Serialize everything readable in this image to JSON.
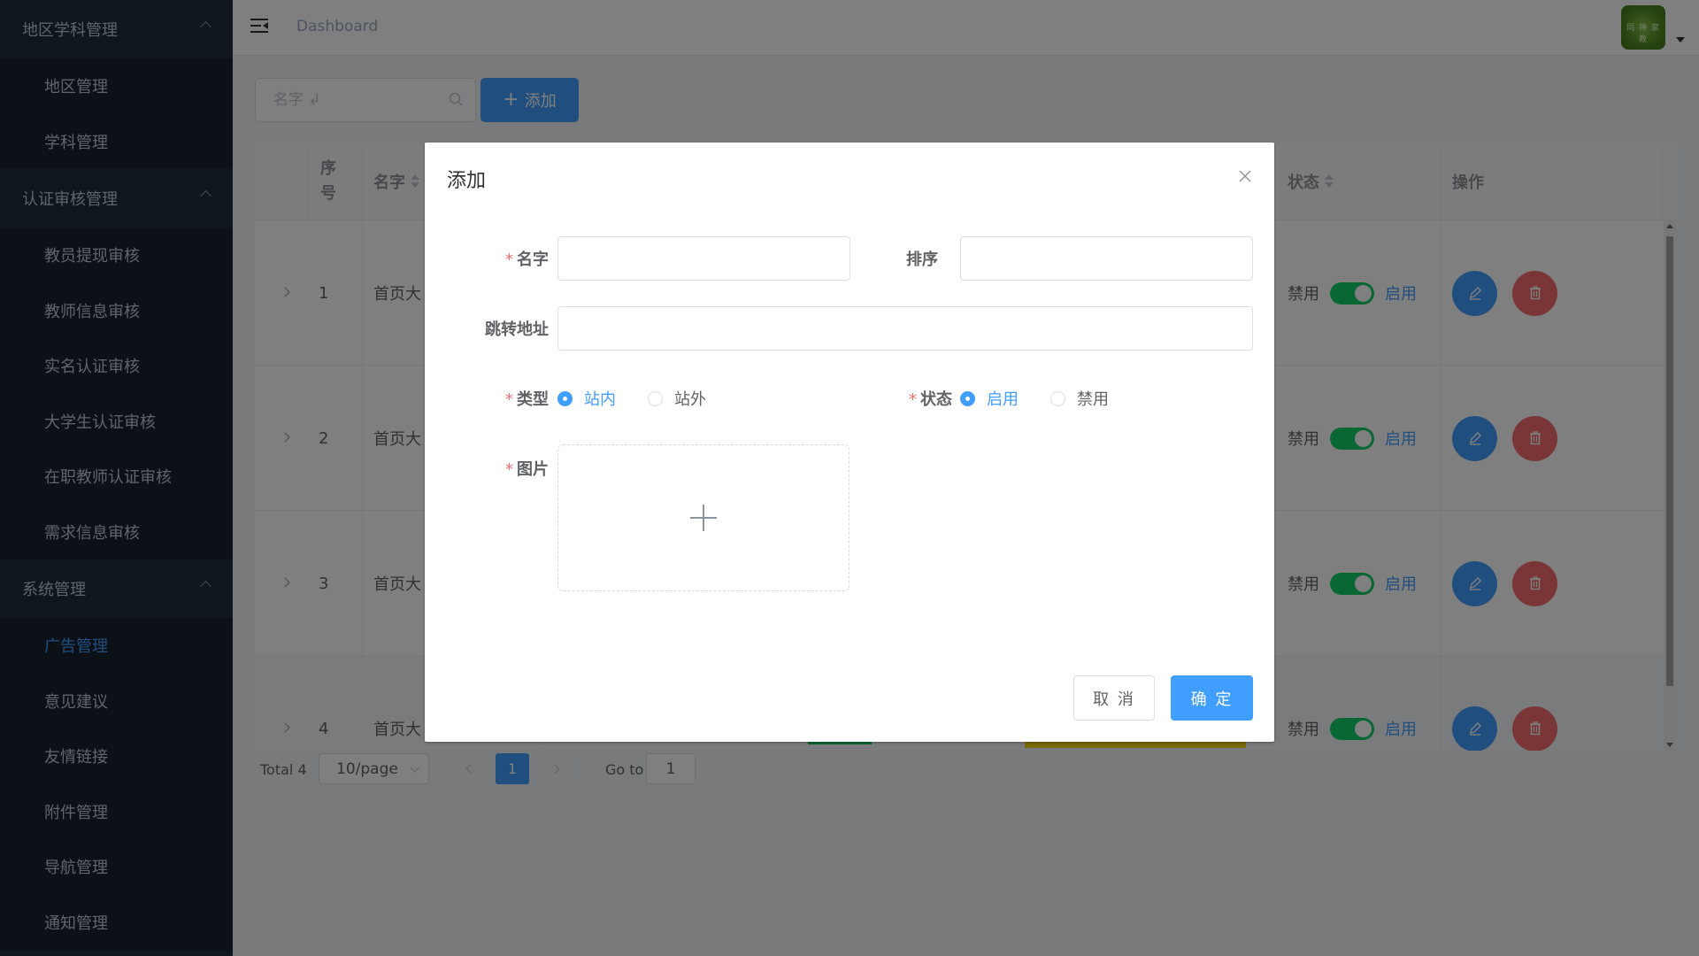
{
  "sidebar": {
    "groups": [
      {
        "label": "地区学科管理",
        "items": [
          "地区管理",
          "学科管理"
        ]
      },
      {
        "label": "认证审核管理",
        "items": [
          "教员提现审核",
          "教师信息审核",
          "实名认证审核",
          "大学生认证审核",
          "在职教师认证审核",
          "需求信息审核"
        ]
      },
      {
        "label": "系统管理",
        "items": [
          "广告管理",
          "意见建议",
          "友情链接",
          "附件管理",
          "导航管理",
          "通知管理"
        ]
      }
    ],
    "active_item": "广告管理"
  },
  "navbar": {
    "breadcrumb": "Dashboard",
    "avatar_text": "同 神 家 教"
  },
  "toolbar": {
    "search_placeholder": "名字 ↲",
    "add_label": "添加"
  },
  "table": {
    "columns": {
      "index": "序号",
      "name": "名字",
      "status": "状态",
      "actions": "操作"
    },
    "rows": [
      {
        "index": "1",
        "name": "首页大",
        "off_label": "禁用",
        "on_label": "启用"
      },
      {
        "index": "2",
        "name": "首页大",
        "off_label": "禁用",
        "on_label": "启用"
      },
      {
        "index": "3",
        "name": "首页大",
        "off_label": "禁用",
        "on_label": "启用"
      },
      {
        "index": "4",
        "name": "首页大",
        "off_label": "禁用",
        "on_label": "启用"
      }
    ]
  },
  "pagination": {
    "total": "Total 4",
    "page_size": "10/page",
    "current_page": "1",
    "goto_label": "Go to",
    "goto_value": "1"
  },
  "dialog": {
    "title": "添加",
    "fields": {
      "name_label": "名字",
      "sort_label": "排序",
      "url_label": "跳转地址",
      "type_label": "类型",
      "status_label": "状态",
      "image_label": "图片"
    },
    "type_options": [
      "站内",
      "站外"
    ],
    "type_selected": "站内",
    "status_options": [
      "启用",
      "禁用"
    ],
    "status_selected": "启用",
    "required_mark": "*",
    "cancel_label": "取 消",
    "confirm_label": "确 定"
  },
  "colors": {
    "sidebar_bg": "#1f2d3d",
    "primary": "#409eff",
    "danger": "#f56c6c",
    "switch_on": "#13ce66"
  }
}
